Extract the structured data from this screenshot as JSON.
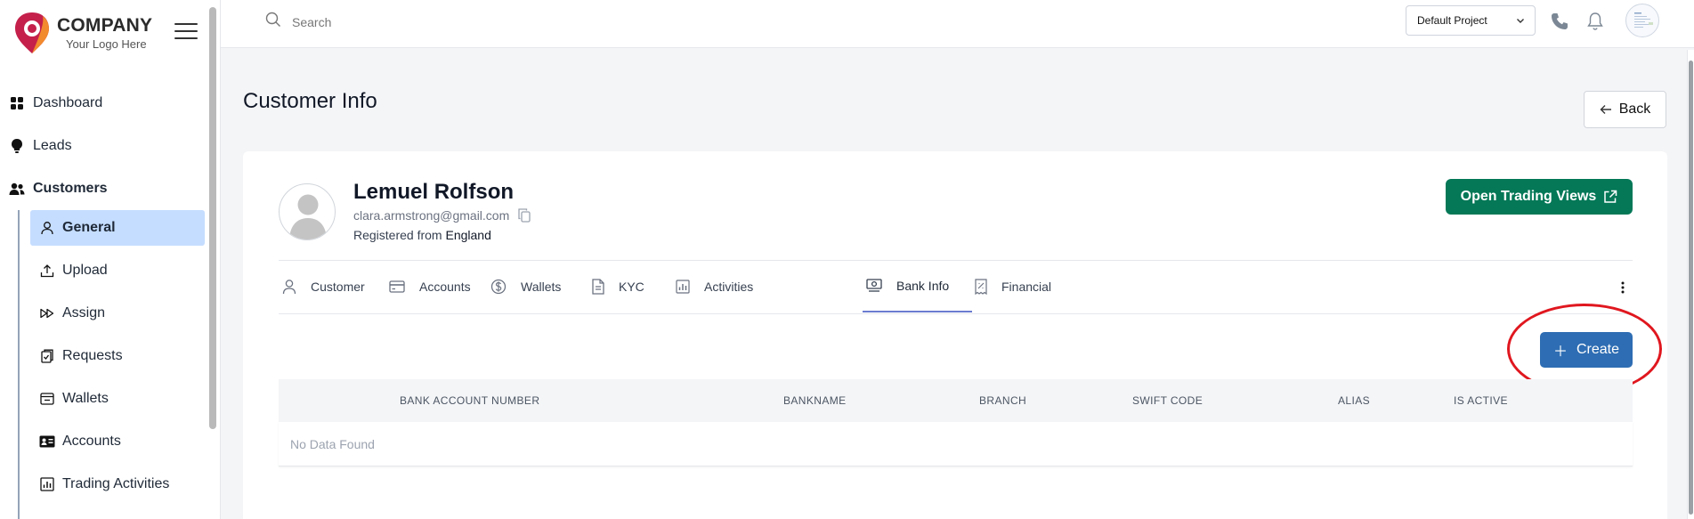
{
  "brand": {
    "name": "COMPANY",
    "tagline": "Your Logo Here"
  },
  "sidebar": {
    "items": [
      {
        "label": "Dashboard",
        "icon": "grid-icon"
      },
      {
        "label": "Leads",
        "icon": "lightbulb-icon"
      },
      {
        "label": "Customers",
        "icon": "users-icon"
      }
    ],
    "sub_items": [
      {
        "label": "General",
        "icon": "user-icon",
        "active": true
      },
      {
        "label": "Upload",
        "icon": "upload-icon"
      },
      {
        "label": "Assign",
        "icon": "fast-forward-icon"
      },
      {
        "label": "Requests",
        "icon": "clipboard-icon"
      },
      {
        "label": "Wallets",
        "icon": "wallet-icon"
      },
      {
        "label": "Accounts",
        "icon": "id-card-icon"
      },
      {
        "label": "Trading Activities",
        "icon": "bar-chart-icon"
      }
    ]
  },
  "header": {
    "search_placeholder": "Search",
    "project": "Default Project"
  },
  "page": {
    "title": "Customer Info",
    "back_label": "Back"
  },
  "customer": {
    "name": "Lemuel Rolfson",
    "email": "clara.armstrong@gmail.com",
    "registered_prefix": "Registered from",
    "country": "England"
  },
  "actions": {
    "trading_views": "Open Trading Views",
    "create": "Create"
  },
  "tabs": [
    {
      "label": "Customer",
      "icon": "user-icon"
    },
    {
      "label": "Accounts",
      "icon": "credit-card-icon"
    },
    {
      "label": "Wallets",
      "icon": "dollar-icon"
    },
    {
      "label": "KYC",
      "icon": "document-icon"
    },
    {
      "label": "Activities",
      "icon": "bar-chart-icon"
    },
    {
      "label": "Bank Info",
      "icon": "cash-icon",
      "active": true
    },
    {
      "label": "Financial",
      "icon": "receipt-icon"
    }
  ],
  "table": {
    "columns": [
      "BANK ACCOUNT NUMBER",
      "BANKNAME",
      "BRANCH",
      "SWIFT CODE",
      "ALIAS",
      "IS ACTIVE"
    ],
    "empty_text": "No Data Found"
  },
  "colors": {
    "accent_green": "#047857",
    "accent_blue": "#2e6db3",
    "active_nav": "#c5ddff",
    "highlight_red": "#e0171f"
  }
}
